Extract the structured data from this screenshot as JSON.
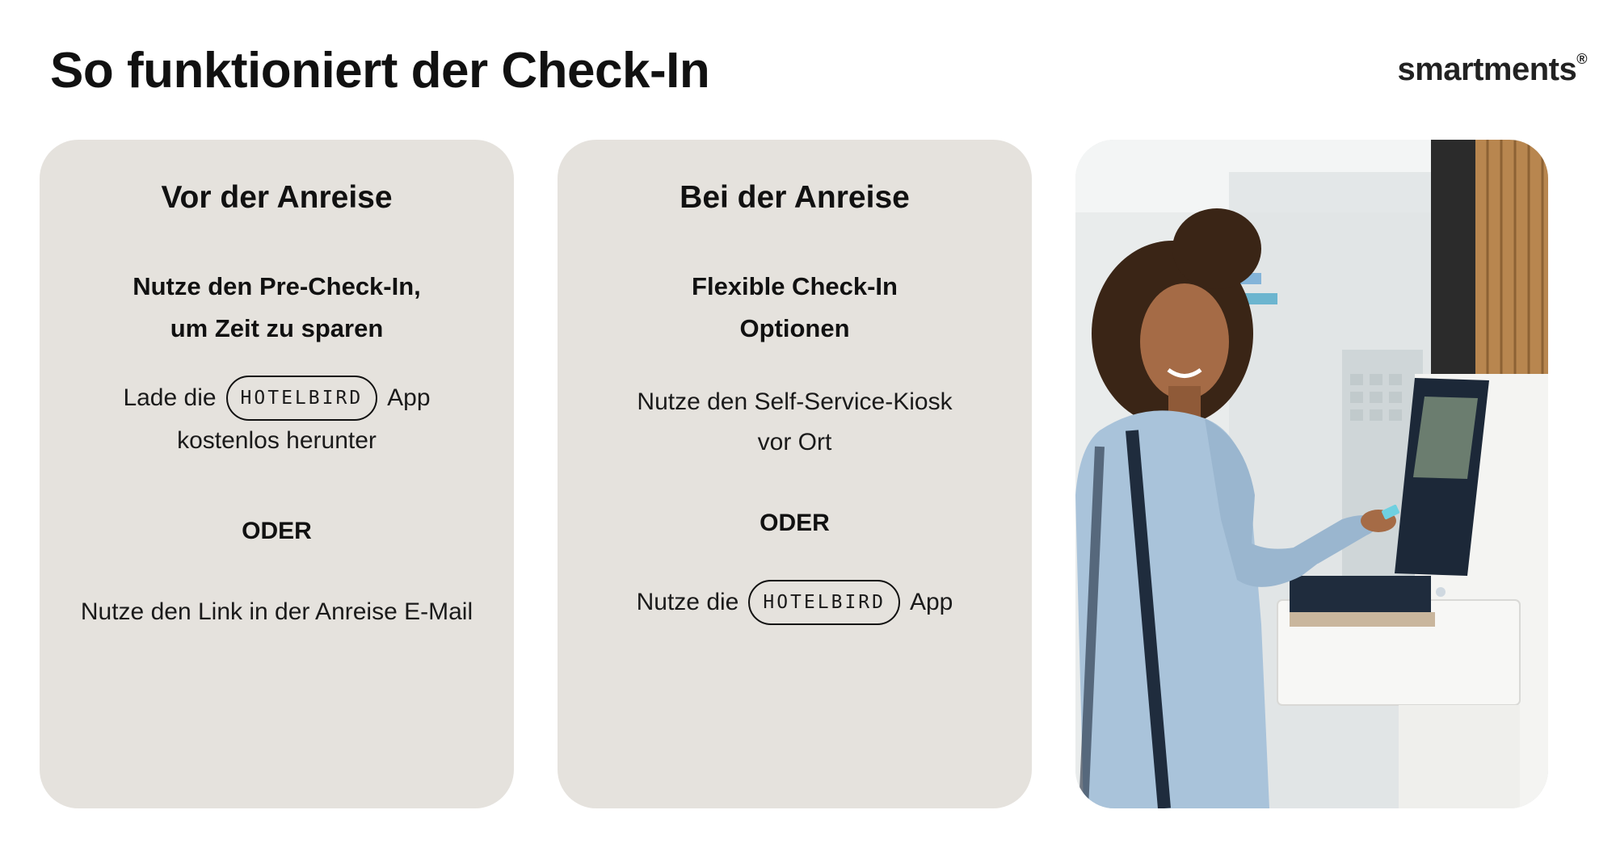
{
  "page": {
    "title": "So funktioniert der Check-In",
    "brand": "smartments",
    "brand_mark": "®"
  },
  "card_before": {
    "title": "Vor der Anreise",
    "subtitle_line1": "Nutze den Pre-Check-In,",
    "subtitle_line2": "um Zeit zu sparen",
    "download_prefix": "Lade die",
    "app_badge": "HOTELBIRD",
    "download_suffix": "App",
    "download_line2": "kostenlos herunter",
    "or_label": "ODER",
    "link_text": "Nutze den Link in der Anreise E-Mail"
  },
  "card_arrival": {
    "title": "Bei der Anreise",
    "subtitle_line1": "Flexible Check-In",
    "subtitle_line2": "Optionen",
    "kiosk_line1": "Nutze den Self-Service-Kiosk",
    "kiosk_line2": "vor Ort",
    "or_label": "ODER",
    "app_prefix": "Nutze die",
    "app_badge": "HOTELBIRD",
    "app_suffix": "App"
  },
  "colors": {
    "card_background": "#e5e2dd",
    "text": "#111111",
    "wood_panel": "#b8864f",
    "denim": "#a9c3da"
  },
  "photo": {
    "subject": "woman-using-check-in-kiosk"
  }
}
